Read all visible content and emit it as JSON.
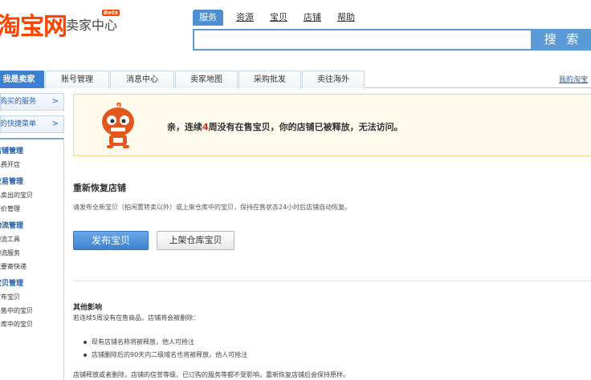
{
  "header": {
    "logo_text": "淘宝网",
    "logo_sub": "卖家中心",
    "logo_badge": "Beta",
    "brand_color": "#ff4400",
    "search_tabs": [
      "服务",
      "资源",
      "宝贝",
      "店铺",
      "帮助"
    ],
    "search_active_index": 0,
    "search_value": "",
    "search_button": "搜 索"
  },
  "nav": {
    "tabs": [
      "我是卖家",
      "账号管理",
      "消息中心",
      "卖家地图",
      "采购批发",
      "卖往海外"
    ],
    "active_index": 0,
    "right_link": "我的淘宝"
  },
  "sidebar": {
    "top_links": [
      {
        "label": "我购买的服务",
        "arrow": ">"
      },
      {
        "label": "我的快捷菜单",
        "arrow": ">"
      }
    ],
    "groups": [
      {
        "title": "店铺管理",
        "items": [
          "免费开店"
        ]
      },
      {
        "title": "交易管理",
        "items": [
          "已卖出的宝贝",
          "评价管理"
        ]
      },
      {
        "title": "物流管理",
        "items": [
          "物流工具",
          "物流服务",
          "我要寄快递"
        ]
      },
      {
        "title": "宝贝管理",
        "items": [
          "发布宝贝",
          "出售中的宝贝",
          "仓库中的宝贝"
        ]
      }
    ]
  },
  "notice": {
    "text_before": "亲，连续",
    "weeks": "4",
    "text_after": "周没有在售宝贝，你的店铺已被释放，无法访问。",
    "mascot_icon": "taobao-mascot-icon"
  },
  "restore": {
    "title": "重新恢复店铺",
    "description": "请发布全新宝贝（拍闲置转卖以外）或上架仓库中的宝贝，保持在售状态24小时后店铺自动恢复。",
    "publish_button": "发布宝贝",
    "shelve_button": "上架仓库宝贝"
  },
  "impact": {
    "title": "其他影响",
    "description": "若连续5周没有在售商品，店铺将会被删除：",
    "items": [
      "现有店铺名称将被释放，他人可抢注",
      "店铺删除后的90天内二级域名也将被释放，他人可抢注"
    ],
    "footer": "店铺释放或者删除，店铺的信誉等级、已订购的服务等都不受影响，重新恢复店铺后会保持原样。"
  },
  "colors": {
    "primary_blue": "#3d7fd0",
    "notice_bg": "#fffbec",
    "notice_border": "#f1d48e",
    "highlight_red": "#e22222"
  }
}
